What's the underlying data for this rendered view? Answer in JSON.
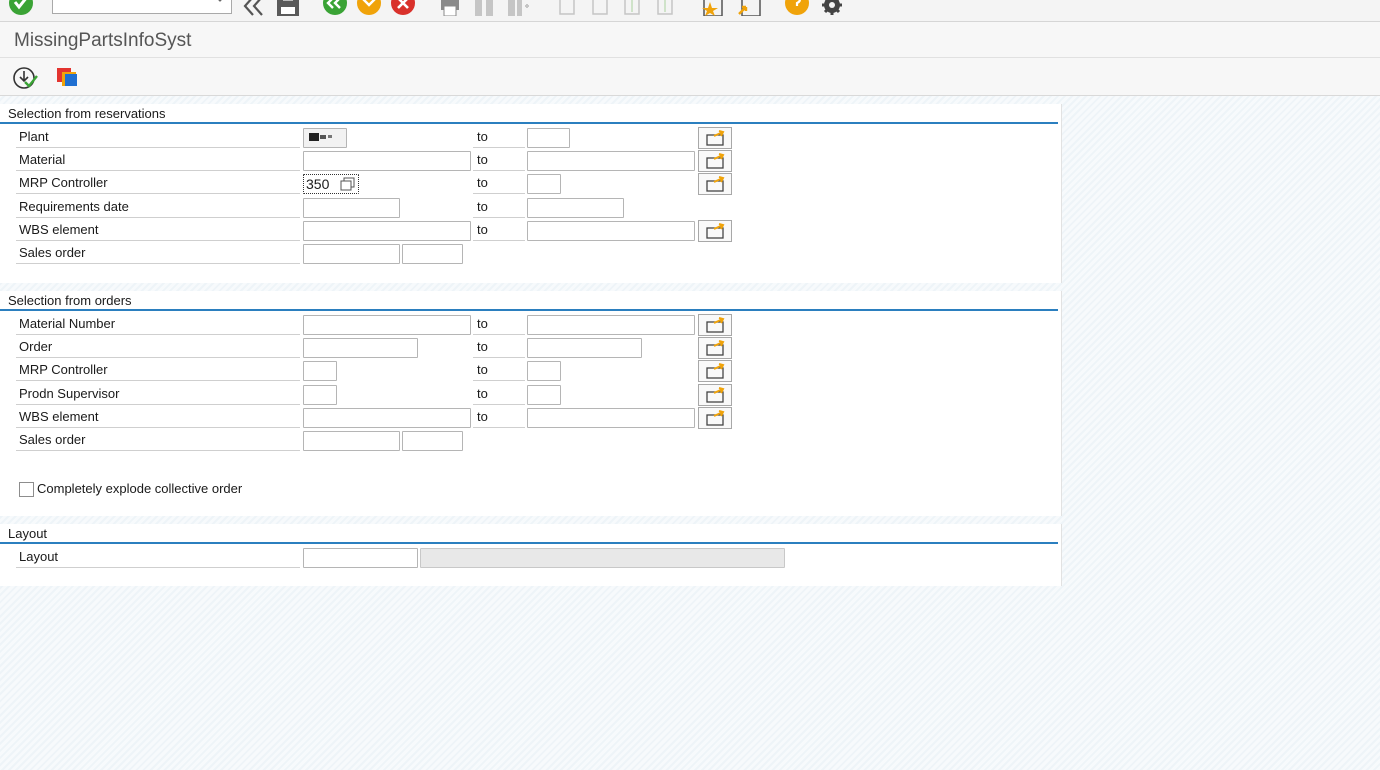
{
  "screen": {
    "title": "MissingPartsInfoSyst"
  },
  "command_field": {
    "value": ""
  },
  "reservations": {
    "title": "Selection from reservations",
    "to_label": "to",
    "rows": [
      {
        "label": "Plant",
        "low": "",
        "high": ""
      },
      {
        "label": "Material",
        "low": "",
        "high": ""
      },
      {
        "label": "MRP Controller",
        "low": "350",
        "high": ""
      },
      {
        "label": "Requirements date",
        "low": "",
        "high": ""
      },
      {
        "label": "WBS element",
        "low": "",
        "high": ""
      },
      {
        "label": "Sales order",
        "low": "",
        "item": ""
      }
    ]
  },
  "orders": {
    "title": "Selection from orders",
    "to_label": "to",
    "rows": [
      {
        "label": "Material Number",
        "low": "",
        "high": ""
      },
      {
        "label": "Order",
        "low": "",
        "high": ""
      },
      {
        "label": "MRP Controller",
        "low": "",
        "high": ""
      },
      {
        "label": "Prodn Supervisor",
        "low": "",
        "high": ""
      },
      {
        "label": "WBS element",
        "low": "",
        "high": ""
      },
      {
        "label": "Sales order",
        "low": "",
        "item": ""
      }
    ],
    "checkbox_label": "Completely explode collective order",
    "checkbox_checked": false
  },
  "layout": {
    "title": "Layout",
    "rows": [
      {
        "label": "Layout",
        "value": "",
        "description": ""
      }
    ]
  },
  "colors": {
    "accent": "#2b7fbf",
    "ok_green": "#3aa335",
    "cancel_red": "#d9312b",
    "orange": "#f0a30a"
  },
  "icons": [
    "enter-icon",
    "save-icon",
    "back-icon",
    "exit-icon",
    "cancel-icon",
    "print-icon",
    "find-icon",
    "find-next-icon",
    "first-page-icon",
    "previous-page-icon",
    "next-page-icon",
    "last-page-icon",
    "bookmark-icon",
    "shortcut-icon",
    "help-icon",
    "settings-icon",
    "execute-icon",
    "get-variant-icon",
    "multiple-selection-icon"
  ]
}
